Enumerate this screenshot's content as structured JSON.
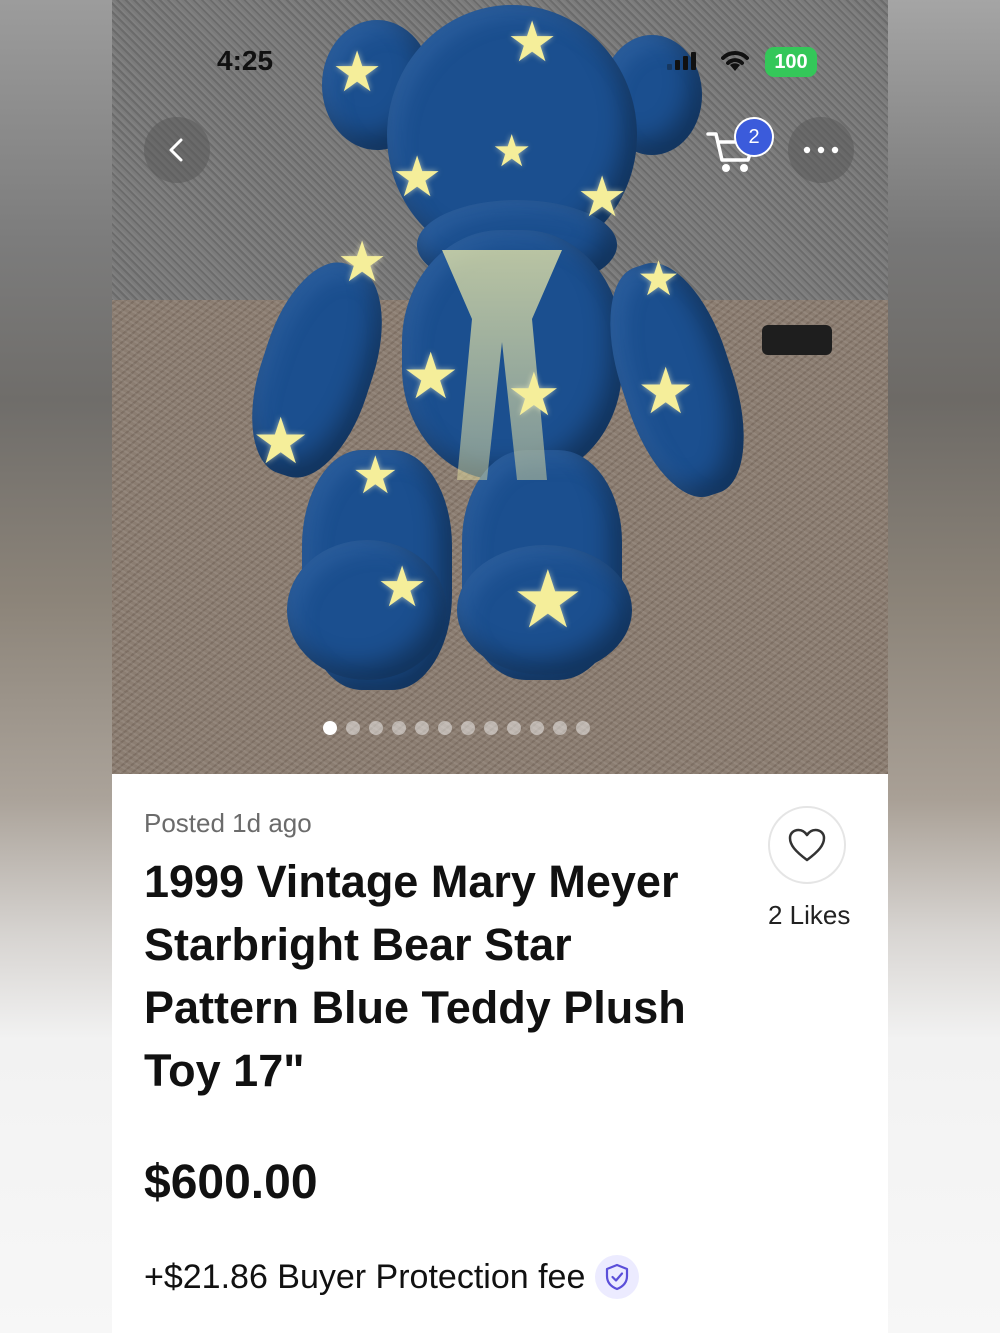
{
  "status_bar": {
    "time": "4:25",
    "battery": "100"
  },
  "header": {
    "cart_count": "2"
  },
  "gallery": {
    "total_images": 12,
    "active_index": 0
  },
  "listing": {
    "posted": "Posted 1d ago",
    "title": "1999 Vintage Mary Meyer Starbright Bear Star Pattern Blue Teddy Plush Toy 17\"",
    "likes": "2 Likes",
    "price": "$600.00",
    "fee": "+$21.86 Buyer Protection fee"
  },
  "colors": {
    "accent": "#3b5bdb",
    "battery": "#34c759",
    "shield_bg": "#ecebff"
  },
  "icons": [
    "back-chevron-icon",
    "cart-icon",
    "more-icon",
    "heart-icon",
    "shield-check-icon",
    "wifi-icon",
    "signal-icon"
  ]
}
